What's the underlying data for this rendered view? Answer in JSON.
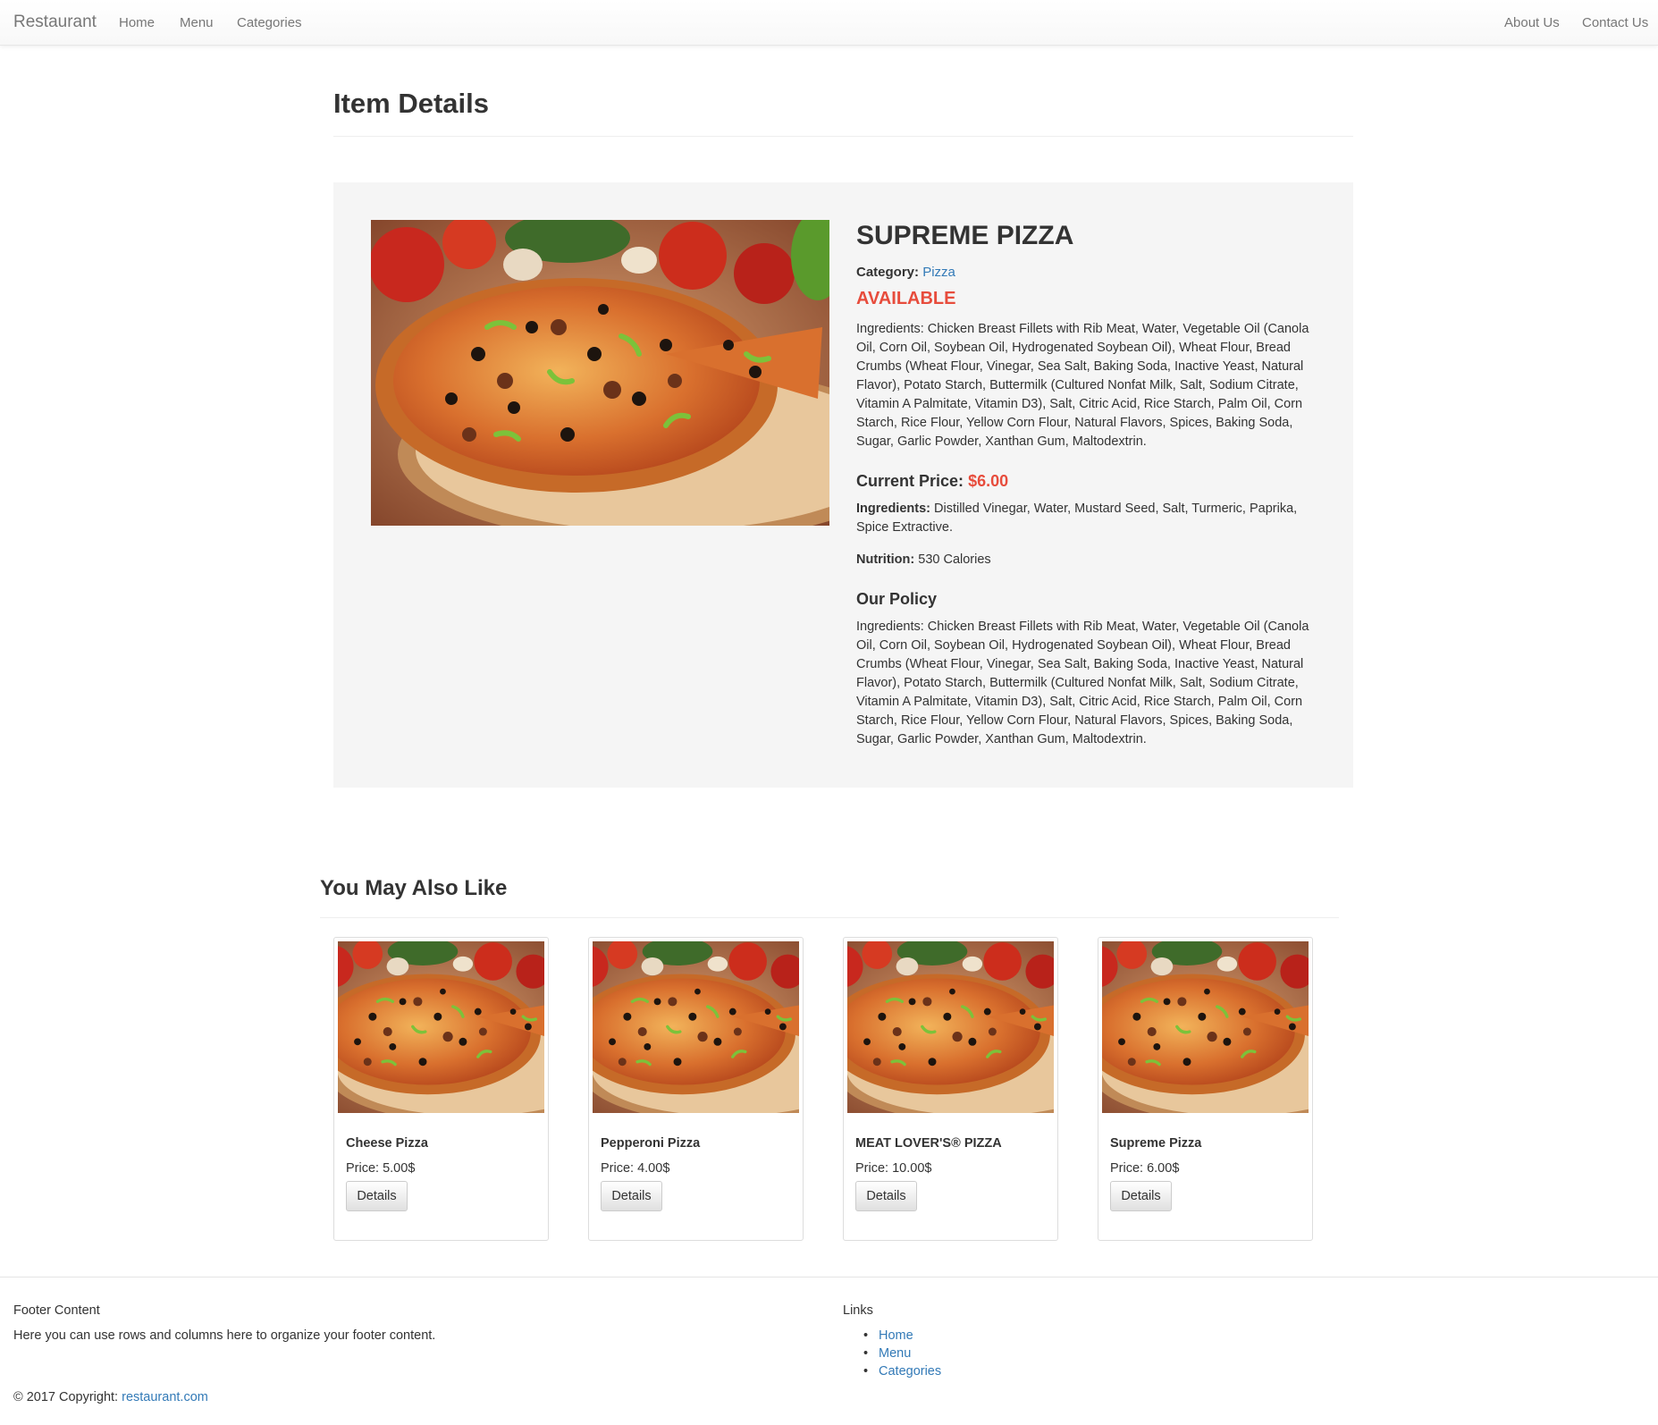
{
  "navbar": {
    "brand": "Restaurant",
    "left_links": [
      "Home",
      "Menu",
      "Categories"
    ],
    "right_links": [
      "About Us",
      "Contact Us"
    ]
  },
  "page": {
    "title": "Item Details"
  },
  "item": {
    "name": "SUPREME PIZZA",
    "category_label": "Category:",
    "category_value": "Pizza",
    "status": "AVAILABLE",
    "ingredients_text": "Ingredients: Chicken Breast Fillets with Rib Meat, Water, Vegetable Oil (Canola Oil, Corn Oil, Soybean Oil, Hydrogenated Soybean Oil), Wheat Flour, Bread Crumbs (Wheat Flour, Vinegar, Sea Salt, Baking Soda, Inactive Yeast, Natural Flavor), Potato Starch, Buttermilk (Cultured Nonfat Milk, Salt, Sodium Citrate, Vitamin A Palmitate, Vitamin D3), Salt, Citric Acid, Rice Starch, Palm Oil, Corn Starch, Rice Flour, Yellow Corn Flour, Natural Flavors, Spices, Baking Soda, Sugar, Garlic Powder, Xanthan Gum, Maltodextrin.",
    "price_label": "Current Price:",
    "price_value": "$6.00",
    "ingredients2_label": "Ingredients:",
    "ingredients2_value": "Distilled Vinegar, Water, Mustard Seed, Salt, Turmeric, Paprika, Spice Extractive.",
    "nutrition_label": "Nutrition:",
    "nutrition_value": "530 Calories",
    "policy_title": "Our Policy",
    "policy_text": "Ingredients: Chicken Breast Fillets with Rib Meat, Water, Vegetable Oil (Canola Oil, Corn Oil, Soybean Oil, Hydrogenated Soybean Oil), Wheat Flour, Bread Crumbs (Wheat Flour, Vinegar, Sea Salt, Baking Soda, Inactive Yeast, Natural Flavor), Potato Starch, Buttermilk (Cultured Nonfat Milk, Salt, Sodium Citrate, Vitamin A Palmitate, Vitamin D3), Salt, Citric Acid, Rice Starch, Palm Oil, Corn Starch, Rice Flour, Yellow Corn Flour, Natural Flavors, Spices, Baking Soda, Sugar, Garlic Powder, Xanthan Gum, Maltodextrin."
  },
  "related": {
    "title": "You May Also Like",
    "button_label": "Details",
    "items": [
      {
        "name": "Cheese Pizza",
        "price": "Price: 5.00$"
      },
      {
        "name": "Pepperoni Pizza",
        "price": "Price: 4.00$"
      },
      {
        "name": "MEAT LOVER'S® PIZZA",
        "price": "Price: 10.00$"
      },
      {
        "name": "Supreme Pizza",
        "price": "Price: 6.00$"
      }
    ]
  },
  "footer": {
    "heading": "Footer Content",
    "text": "Here you can use rows and columns here to organize your footer content.",
    "links_heading": "Links",
    "links": [
      "Home",
      "Menu",
      "Categories"
    ],
    "copyright_prefix": "© 2017 Copyright:",
    "copyright_link": "restaurant.com"
  },
  "colors": {
    "accent": "#e74c3c",
    "link": "#337ab7",
    "panel": "#f5f5f5"
  },
  "icons": {
    "hero_image": "pizza-photo",
    "card_image": "pizza-photo"
  }
}
